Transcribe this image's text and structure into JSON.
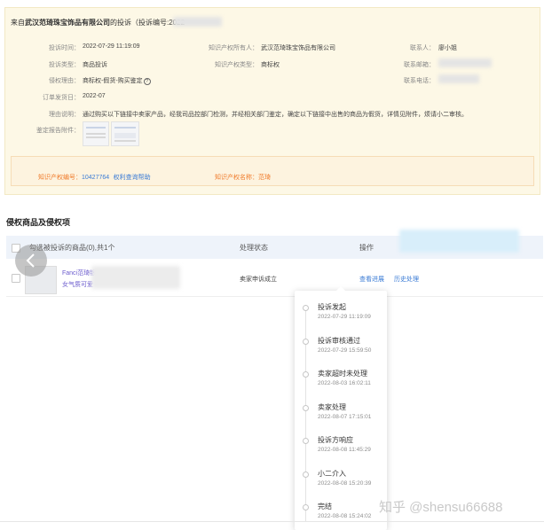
{
  "header": {
    "prefix": "来自",
    "company": "武汉范琦珠宝饰品有限公司",
    "suffix": "的投诉（投诉编号:2022"
  },
  "info": {
    "complaint_time_label": "投诉时间：",
    "complaint_time": "2022-07-29 11:19:09",
    "owner_label": "知识产权所有人：",
    "owner": "武汉范琦珠宝饰品有限公司",
    "contact_label": "联系人：",
    "contact": "廖小姐",
    "complaint_type_label": "投诉类型：",
    "complaint_type": "商品投诉",
    "ip_type_label": "知识产权类型：",
    "ip_type": "商标权",
    "email_label": "联系邮箱：",
    "reason_label": "侵权理由：",
    "reason": "商标权-假货-购买鉴定",
    "phone_label": "联系电话：",
    "order_date_label": "订单发货日：",
    "order_date": "2022-07",
    "explain_label": "理由说明：",
    "explain": "通过购买以下链接中卖家产品，经我司品控部门检测，并经相关部门鉴定，确定以下链接中出售的商品为假货，详情见附件，烦请小二审核。",
    "attachment_label": "鉴定报告附件："
  },
  "ip_bar": {
    "number_label": "知识产权编号：",
    "number": "10427764",
    "help_link": "权利查询帮助",
    "name_label": "知识产权名称：",
    "name": "范琦"
  },
  "section_title": "侵权商品及侵权项",
  "table": {
    "col_goods": "勾选被投诉的商品(0),共1个",
    "col_status": "处理状态",
    "col_action": "操作",
    "row": {
      "product_line1": "Fanci范琦银",
      "product_line2": "女气质可爱",
      "status": "卖家申诉成立",
      "view_progress": "查看进展",
      "history": "历史处理"
    }
  },
  "timeline": [
    {
      "title": "投诉发起",
      "date": "2022-07-29 11:19:09"
    },
    {
      "title": "投诉审核通过",
      "date": "2022-07-29 15:59:50"
    },
    {
      "title": "卖家超时未处理",
      "date": "2022-08-03 16:02:11"
    },
    {
      "title": "卖家处理",
      "date": "2022-08-07 17:15:01"
    },
    {
      "title": "投诉方响应",
      "date": "2022-08-08 11:45:29"
    },
    {
      "title": "小二介入",
      "date": "2022-08-08 15:20:39"
    },
    {
      "title": "完结",
      "date": "2022-08-08 15:24:02"
    }
  ],
  "watermark": "知乎 @shensu66688",
  "colors": {
    "accent_orange": "#f07b2b",
    "link_blue": "#3a7bd5",
    "panel_bg": "#fdf8e6"
  }
}
